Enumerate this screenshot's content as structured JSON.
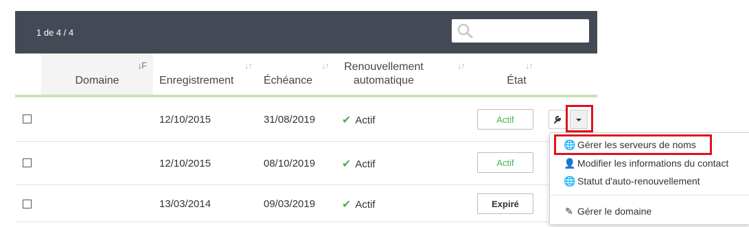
{
  "toolbar": {
    "pager": "1 de 4 / 4",
    "search_value": "",
    "icon": "search-icon"
  },
  "columns": {
    "domain": "Domaine",
    "registration": "Enregistrement",
    "expiry": "Échéance",
    "renew_line1": "Renouvellement",
    "renew_line2": "automatique",
    "state": "État"
  },
  "rows": [
    {
      "domain": "",
      "registration": "12/10/2015",
      "expiry": "31/08/2019",
      "auto_renew": "Actif",
      "state": "Actif"
    },
    {
      "domain": "",
      "registration": "12/10/2015",
      "expiry": "08/10/2019",
      "auto_renew": "Actif",
      "state": "Actif"
    },
    {
      "domain": "",
      "registration": "13/03/2014",
      "expiry": "09/03/2019",
      "auto_renew": "Actif",
      "state": "Expiré"
    }
  ],
  "menu": {
    "items": [
      {
        "label": "Gérer les serveurs de noms",
        "icon": "globe-icon"
      },
      {
        "label": "Modifier les informations du contact",
        "icon": "user-icon"
      },
      {
        "label": "Statut d'auto-renouvellement",
        "icon": "globe-icon"
      },
      {
        "label": "Gérer le domaine",
        "icon": "pencil-icon"
      }
    ]
  },
  "colors": {
    "header_bg": "#444a55",
    "accent_green": "#8bc34a",
    "active_green": "#4caf50",
    "highlight_red": "#e0101a"
  }
}
